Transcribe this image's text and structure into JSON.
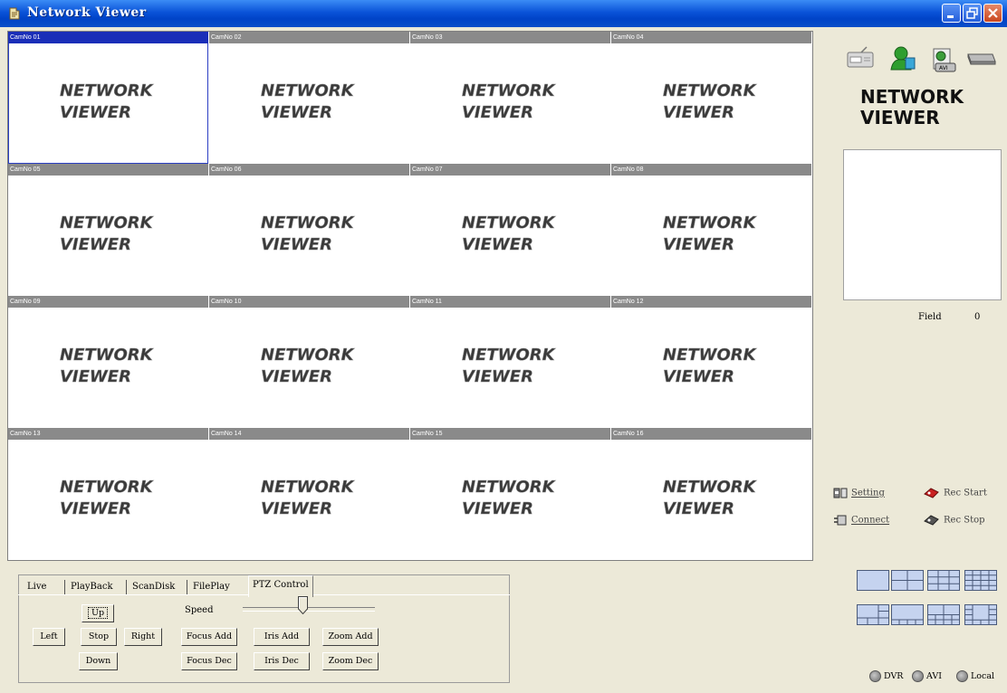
{
  "window": {
    "title": "Network Viewer",
    "titlebar_color": "#0a53d8"
  },
  "cameras": [
    {
      "label": "CamNo 01",
      "logo_line1": "NETWORK",
      "logo_line2": "VIEWER",
      "selected": true
    },
    {
      "label": "CamNo 02",
      "logo_line1": "NETWORK",
      "logo_line2": "VIEWER"
    },
    {
      "label": "CamNo 03",
      "logo_line1": "NETWORK",
      "logo_line2": "VIEWER"
    },
    {
      "label": "CamNo 04",
      "logo_line1": "NETWORK",
      "logo_line2": "VIEWER"
    },
    {
      "label": "CamNo 05",
      "logo_line1": "NETWORK",
      "logo_line2": "VIEWER"
    },
    {
      "label": "CamNo 06",
      "logo_line1": "NETWORK",
      "logo_line2": "VIEWER"
    },
    {
      "label": "CamNo 07",
      "logo_line1": "NETWORK",
      "logo_line2": "VIEWER"
    },
    {
      "label": "CamNo 08",
      "logo_line1": "NETWORK",
      "logo_line2": "VIEWER"
    },
    {
      "label": "CamNo 09",
      "logo_line1": "NETWORK",
      "logo_line2": "VIEWER"
    },
    {
      "label": "CamNo 10",
      "logo_line1": "NETWORK",
      "logo_line2": "VIEWER"
    },
    {
      "label": "CamNo 11",
      "logo_line1": "NETWORK",
      "logo_line2": "VIEWER"
    },
    {
      "label": "CamNo 12",
      "logo_line1": "NETWORK",
      "logo_line2": "VIEWER"
    },
    {
      "label": "CamNo 13",
      "logo_line1": "NETWORK",
      "logo_line2": "VIEWER"
    },
    {
      "label": "CamNo 14",
      "logo_line1": "NETWORK",
      "logo_line2": "VIEWER"
    },
    {
      "label": "CamNo 15",
      "logo_line1": "NETWORK",
      "logo_line2": "VIEWER"
    },
    {
      "label": "CamNo 16",
      "logo_line1": "NETWORK",
      "logo_line2": "VIEWER"
    }
  ],
  "tabs": [
    "Live",
    "PlayBack",
    "ScanDisk",
    "FilePlay",
    "PTZ Control"
  ],
  "active_tab": "PTZ Control",
  "ptz": {
    "up": "Up",
    "down": "Down",
    "left": "Left",
    "stop": "Stop",
    "right": "Right",
    "speed_label": "Speed",
    "speed_level": 0.45,
    "focus_add": "Focus Add",
    "focus_dec": "Focus Dec",
    "iris_add": "Iris Add",
    "iris_dec": "Iris Dec",
    "zoom_add": "Zoom Add",
    "zoom_dec": "Zoom Dec"
  },
  "sidebar": {
    "toolbar_icons": [
      "dvr-device-icon",
      "user-icon",
      "avi-file-icon",
      "hard-disk-icon"
    ],
    "brand_line1": "NETWORK",
    "brand_line2": "VIEWER",
    "field_label": "Field",
    "field_value": "0",
    "setting": "Setting",
    "rec_start": "Rec Start",
    "connect": "Connect",
    "rec_stop": "Rec Stop",
    "layouts": [
      "1-split",
      "4-split",
      "9-split",
      "16-split",
      "6-split-a",
      "6-split-b",
      "8-split",
      "13-split"
    ],
    "sources": [
      "DVR",
      "AVI",
      "Local"
    ]
  }
}
